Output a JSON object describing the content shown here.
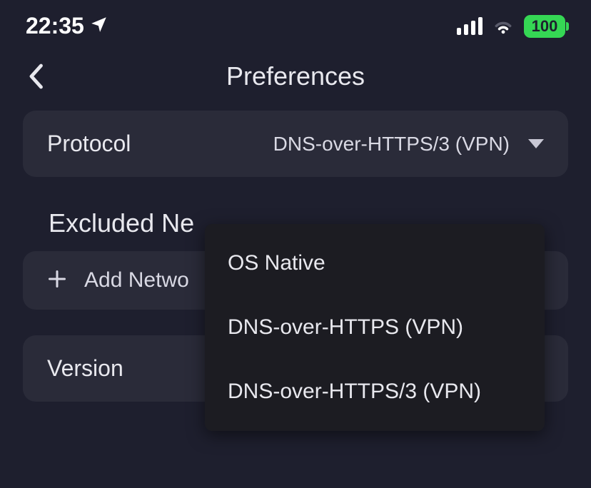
{
  "status": {
    "time": "22:35",
    "battery": "100"
  },
  "header": {
    "title": "Preferences"
  },
  "protocol": {
    "label": "Protocol",
    "selected": "DNS-over-HTTPS/3 (VPN)",
    "options": [
      "OS Native",
      "DNS-over-HTTPS (VPN)",
      "DNS-over-HTTPS/3 (VPN)"
    ]
  },
  "excluded": {
    "section_title": "Excluded Ne",
    "add_label": "Add Netwo"
  },
  "version": {
    "label": "Version"
  }
}
